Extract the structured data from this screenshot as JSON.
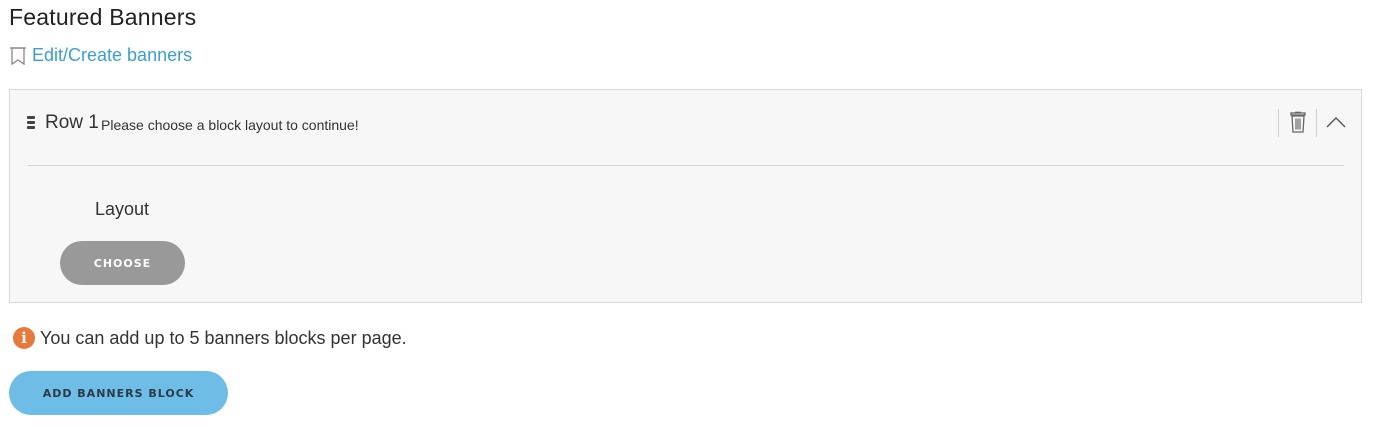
{
  "page": {
    "title": "Featured Banners"
  },
  "edit_link": {
    "label": "Edit/Create banners",
    "icon": "bookmark-icon"
  },
  "row": {
    "label": "Row 1",
    "hint": "Please choose a block layout to continue!",
    "actions": {
      "delete_icon": "trash-icon",
      "collapse_icon": "chevron-up-icon"
    },
    "layout_label": "Layout",
    "choose_label": "CHOOSE"
  },
  "info": {
    "icon": "info-icon",
    "glyph": "i",
    "text": "You can add up to 5 banners blocks per page."
  },
  "add_button": {
    "label": "ADD BANNERS BLOCK"
  },
  "colors": {
    "link": "#3a9fd0",
    "choose_button": "#999999",
    "add_button": "#6dbde6",
    "info_icon": "#e8793a",
    "panel_bg": "#f7f7f7"
  }
}
